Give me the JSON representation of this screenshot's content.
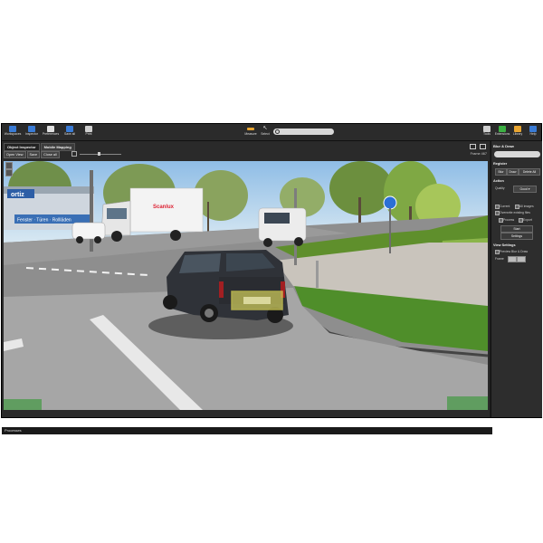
{
  "toolbar": {
    "left_buttons": [
      {
        "label": "Workspaces",
        "icon": "workspaces-icon",
        "color": "#3a7bd5"
      },
      {
        "label": "Inspector",
        "icon": "inspector-icon",
        "color": "#3a7bd5"
      },
      {
        "label": "Preferences",
        "icon": "preferences-icon",
        "color": "#e0e0e0"
      },
      {
        "label": "Save all",
        "icon": "save-icon",
        "color": "#3a7bd5"
      },
      {
        "label": "Print",
        "icon": "print-icon",
        "color": "#d0d0d0"
      }
    ],
    "measure_label": "Measure",
    "select_label": "Select",
    "right_buttons": [
      {
        "label": "Tools",
        "icon": "tools-icon",
        "color": "#cfcfcf"
      },
      {
        "label": "Extensions",
        "icon": "extensions-icon",
        "color": "#3cb043"
      },
      {
        "label": "Library",
        "icon": "library-icon",
        "color": "#e8a531"
      },
      {
        "label": "Help",
        "icon": "help-icon",
        "color": "#3a7bd5"
      }
    ]
  },
  "viewer": {
    "tabs": [
      "Object Inspector",
      "Mobile Mapping"
    ],
    "tools": [
      "Open View",
      "Save",
      "Close all"
    ],
    "frame_label": "Frame 467",
    "status": "Processes"
  },
  "right_panel": {
    "title": "Blur & Draw",
    "register_heading": "Register",
    "register_buttons": [
      "Blur",
      "Draw",
      "Delete All"
    ],
    "action_heading": "Action",
    "quality_label": "Quality",
    "quality_value": "Good",
    "opt_current": "Current",
    "opt_all": "All images",
    "opt_overwrite": "Overwrite existing files",
    "opt_process": "Process",
    "opt_export": "Export",
    "start_label": "Start",
    "settings_label": "Settings",
    "view_settings_heading": "View Settings",
    "preview_label": "Preview Blur & Draw",
    "frame_label": "Frame"
  },
  "scene": {
    "truck_text": "Scanlux",
    "store_sign": "Fenster · Türen · Rollläden"
  }
}
